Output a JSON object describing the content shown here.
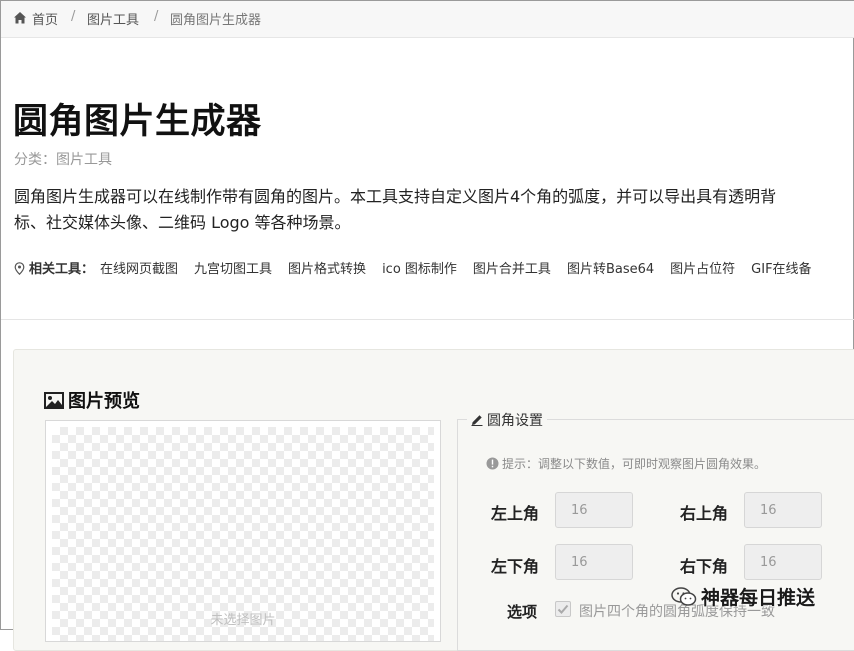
{
  "breadcrumb": {
    "items": [
      "首页",
      "图片工具",
      "圆角图片生成器"
    ],
    "separator": "/",
    "home_icon": "home-icon"
  },
  "header": {
    "title": "圆角图片生成器",
    "category": "分类：图片工具",
    "description_lines": [
      "圆角图片生成器可以在线制作带有圆角的图片。本工具支持自定义图片4个角的弧度，并可以导出具有透明背",
      "标、社交媒体头像、二维码 Logo 等各种场景。"
    ]
  },
  "related": {
    "label": "相关工具：",
    "icon": "map-pin-icon",
    "items": [
      "在线网页截图",
      "九宫切图工具",
      "图片格式转换",
      "ico 图标制作",
      "图片合并工具",
      "图片转Base64",
      "图片占位符",
      "GIF在线备"
    ]
  },
  "preview": {
    "title": "图片预览",
    "icon": "image-icon",
    "placeholder": "未选择图片"
  },
  "settings": {
    "title": "圆角设置",
    "icon": "edit-icon",
    "hint": "提示：调整以下数值，可即时观察图片圆角效果。",
    "hint_icon": "info-icon",
    "fields": {
      "top_left": {
        "label": "左上角",
        "value": "16"
      },
      "top_right": {
        "label": "右上角",
        "value": "16"
      },
      "bottom_left": {
        "label": "左下角",
        "value": "16"
      },
      "bottom_right": {
        "label": "右下角",
        "value": "16"
      }
    },
    "option_label": "选项",
    "option_text": "图片四个角的圆角弧度保持一致",
    "option_checked": true
  },
  "watermark": {
    "text": "神器每日推送",
    "icon": "wechat-icon"
  }
}
